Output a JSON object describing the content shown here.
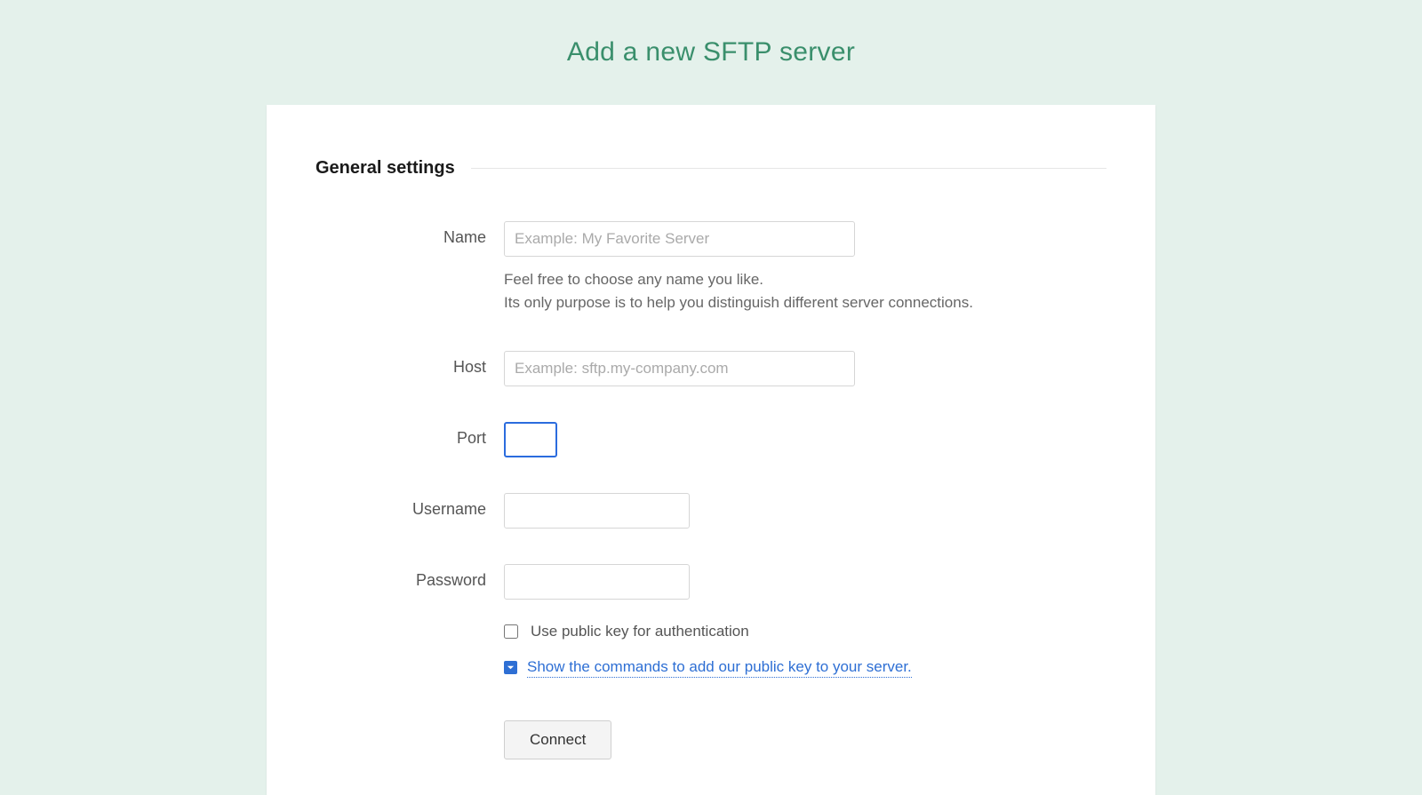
{
  "page": {
    "title": "Add a new SFTP server"
  },
  "section": {
    "heading": "General settings"
  },
  "fields": {
    "name": {
      "label": "Name",
      "placeholder": "Example: My Favorite Server",
      "value": "",
      "help_line1": "Feel free to choose any name you like.",
      "help_line2": "Its only purpose is to help you distinguish different server connections."
    },
    "host": {
      "label": "Host",
      "placeholder": "Example: sftp.my-company.com",
      "value": ""
    },
    "port": {
      "label": "Port",
      "value": ""
    },
    "username": {
      "label": "Username",
      "value": ""
    },
    "password": {
      "label": "Password",
      "value": ""
    }
  },
  "options": {
    "public_key_checkbox": "Use public key for authentication",
    "show_commands_link": "Show the commands to add our public key to your server."
  },
  "actions": {
    "connect": "Connect"
  }
}
